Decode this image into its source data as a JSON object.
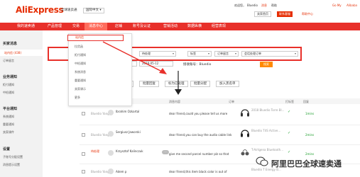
{
  "header": {
    "logo": "AliExpress",
    "logo_sub": "全球速卖通",
    "lang_select": "国际中文",
    "links": [
      "欢迎您，",
      "Bluedio",
      "消息",
      "帮助",
      "Go My",
      "Alibaba"
    ],
    "buttons": [
      "卖家首页",
      "联系客服",
      "帮助中心"
    ]
  },
  "nav": {
    "items": [
      "我的速卖通",
      "产品管理",
      "交易",
      "消息中心",
      "店铺",
      "账号及认证",
      "营销活动",
      "数据纵横",
      "经营表现"
    ],
    "active_index": 3
  },
  "sidebar": {
    "groups": [
      {
        "title": "买家消息",
        "items": [
          "站内信 (438)",
          "订单留言"
        ]
      },
      {
        "title": "业务通知",
        "items": [
          "拒付通知",
          "中检通知"
        ]
      },
      {
        "title": "平台通知",
        "items": [
          "系统通知",
          "重要通知",
          "卖家课件"
        ]
      },
      {
        "title": "设置",
        "items": [
          "子账号分配设置",
          "消息提示设置"
        ]
      }
    ]
  },
  "dropdown": {
    "items": [
      "站内信",
      "拉货函",
      "拒付通知",
      "中检通知",
      "系统消息",
      "重要通知",
      "卖家课示",
      "更多"
    ]
  },
  "filters": {
    "selects": [
      "全部",
      "待处理",
      "标签",
      "订单留言",
      "会话处理订单"
    ],
    "date_label": "日期：",
    "date_from": "2018-05-12",
    "date_to": "",
    "receiver_label": "接收账号：Bluedio",
    "search_button": "搜索"
  },
  "actions": [
    "批量已读",
    "批量回复",
    "标为已处理",
    "批量分配",
    "加入黑名单"
  ],
  "table": {
    "headers": [
      "买家",
      "消息内容",
      "订单",
      "打标签",
      "回复"
    ],
    "rows": [
      {
        "agent": "Bluedio Yang",
        "buyer": "Ibrahim Ozkartal",
        "msg": "dear friend,could you please tell us more",
        "order": "2018 Bluedio Torre Bl...",
        "status": "✓",
        "time": "1mins"
      },
      {
        "agent": "Bluedio Yang",
        "buyer": "Sergiusz Jaworski",
        "msg": "dear friend,you can buy the audio cable link",
        "order": "Bluedio T4S Active...",
        "status": "✓",
        "time": "2mins"
      },
      {
        "agent": "待处理",
        "buyer": "Krzysztof Kalinczuk",
        "msg": "give me second parcel number plz so that",
        "order": "T-Airtgena Bluetooth...",
        "status": "✓",
        "time": "2mins"
      },
      {
        "agent": "Bluedio Yang",
        "buyer": "Adem p",
        "msg": "dear friend,this item black color is out of",
        "order": "Bluedio T Energy B...",
        "status": "✓",
        "time": "1mins"
      }
    ]
  },
  "watermark": "阿里巴巴全球速卖通",
  "colors": {
    "brand_red": "#e8302a",
    "accent_orange": "#ff8a00",
    "success_green": "#1c9e2b"
  }
}
